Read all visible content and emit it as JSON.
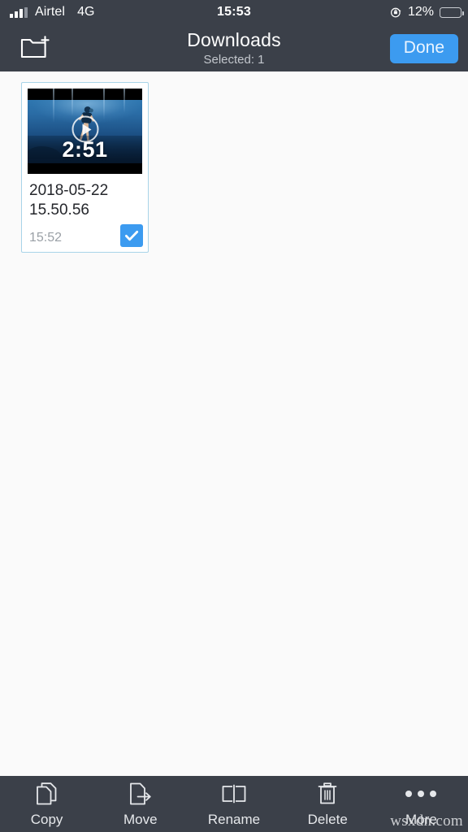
{
  "status_bar": {
    "carrier": "Airtel",
    "network": "4G",
    "time": "15:53",
    "battery_percent": "12%",
    "battery_level": 12,
    "rotation_lock_icon": "rotation-lock-icon",
    "signal_icon": "signal-bars-icon",
    "battery_color": "#e8453c"
  },
  "nav_bar": {
    "new_folder_icon": "new-folder-icon",
    "title": "Downloads",
    "subtitle": "Selected: 1",
    "done_label": "Done",
    "accent_color": "#3c9bf0",
    "background_color": "#3b4049"
  },
  "content": {
    "items": [
      {
        "name": "2018-05-22 15.50.56",
        "time": "15:52",
        "duration": "2:51",
        "type": "video",
        "selected": true,
        "play_icon": "play-circle-icon",
        "check_icon": "check-icon"
      }
    ]
  },
  "toolbar": {
    "items": [
      {
        "label": "Copy",
        "icon": "copy-icon"
      },
      {
        "label": "Move",
        "icon": "move-icon"
      },
      {
        "label": "Rename",
        "icon": "rename-icon"
      },
      {
        "label": "Delete",
        "icon": "trash-icon"
      },
      {
        "label": "More",
        "icon": "ellipsis-icon"
      }
    ]
  },
  "watermark": {
    "text": "wsxdn.com"
  }
}
